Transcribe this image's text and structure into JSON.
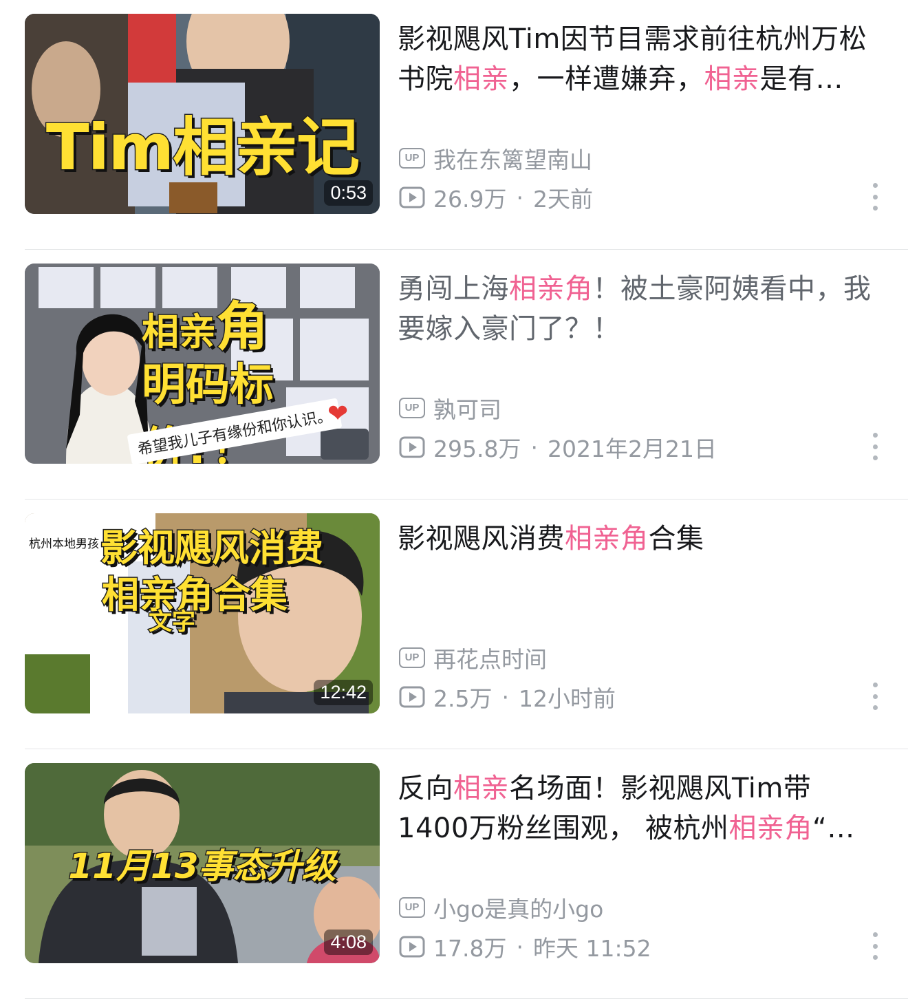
{
  "accent_color": "#f06292",
  "videos": [
    {
      "thumb_text": "Tim相亲记",
      "duration": "0:53",
      "title": [
        {
          "t": "影视飓风Tim因节目需求前往杭州万松书院",
          "hl": false
        },
        {
          "t": "相亲",
          "hl": true
        },
        {
          "t": "，一样遭嫌弃，",
          "hl": false
        },
        {
          "t": "相亲",
          "hl": true
        },
        {
          "t": "是有…",
          "hl": false
        }
      ],
      "visited": false,
      "up_badge": "UP",
      "author": "我在东篱望南山",
      "views": "26.9万",
      "time": "2天前"
    },
    {
      "thumb_text_1": "相亲",
      "thumb_text_2": "角",
      "thumb_text_3": "明码标价?！",
      "thumb_caption": "希望我儿子有缘份和你认识。",
      "title": [
        {
          "t": "勇闯上海",
          "hl": false
        },
        {
          "t": "相亲角",
          "hl": true
        },
        {
          "t": "！被土豪阿姨看中，我要嫁入豪门了？！",
          "hl": false
        }
      ],
      "visited": true,
      "up_badge": "UP",
      "author": "孰可司",
      "views": "295.8万",
      "time": "2021年2月21日"
    },
    {
      "thumb_text_1": "影视飓风消费",
      "thumb_text_2": "相亲角合集",
      "thumb_text_3": "文字",
      "thumb_doc_title": "杭州本地男孩",
      "duration": "12:42",
      "title": [
        {
          "t": "影视飓风消费",
          "hl": false
        },
        {
          "t": "相亲角",
          "hl": true
        },
        {
          "t": "合集",
          "hl": false
        }
      ],
      "visited": false,
      "up_badge": "UP",
      "author": "再花点时间",
      "views": "2.5万",
      "time": "12小时前"
    },
    {
      "thumb_text": "11月13事态升级",
      "duration": "4:08",
      "title": [
        {
          "t": "反向",
          "hl": false
        },
        {
          "t": "相亲",
          "hl": true
        },
        {
          "t": "名场面！影视飓风Tim带1400万粉丝围观， 被杭州",
          "hl": false
        },
        {
          "t": "相亲角",
          "hl": true
        },
        {
          "t": "“…",
          "hl": false
        }
      ],
      "visited": false,
      "up_badge": "UP",
      "author": "小go是真的小go",
      "views": "17.8万",
      "time": "昨天 11:52"
    }
  ]
}
